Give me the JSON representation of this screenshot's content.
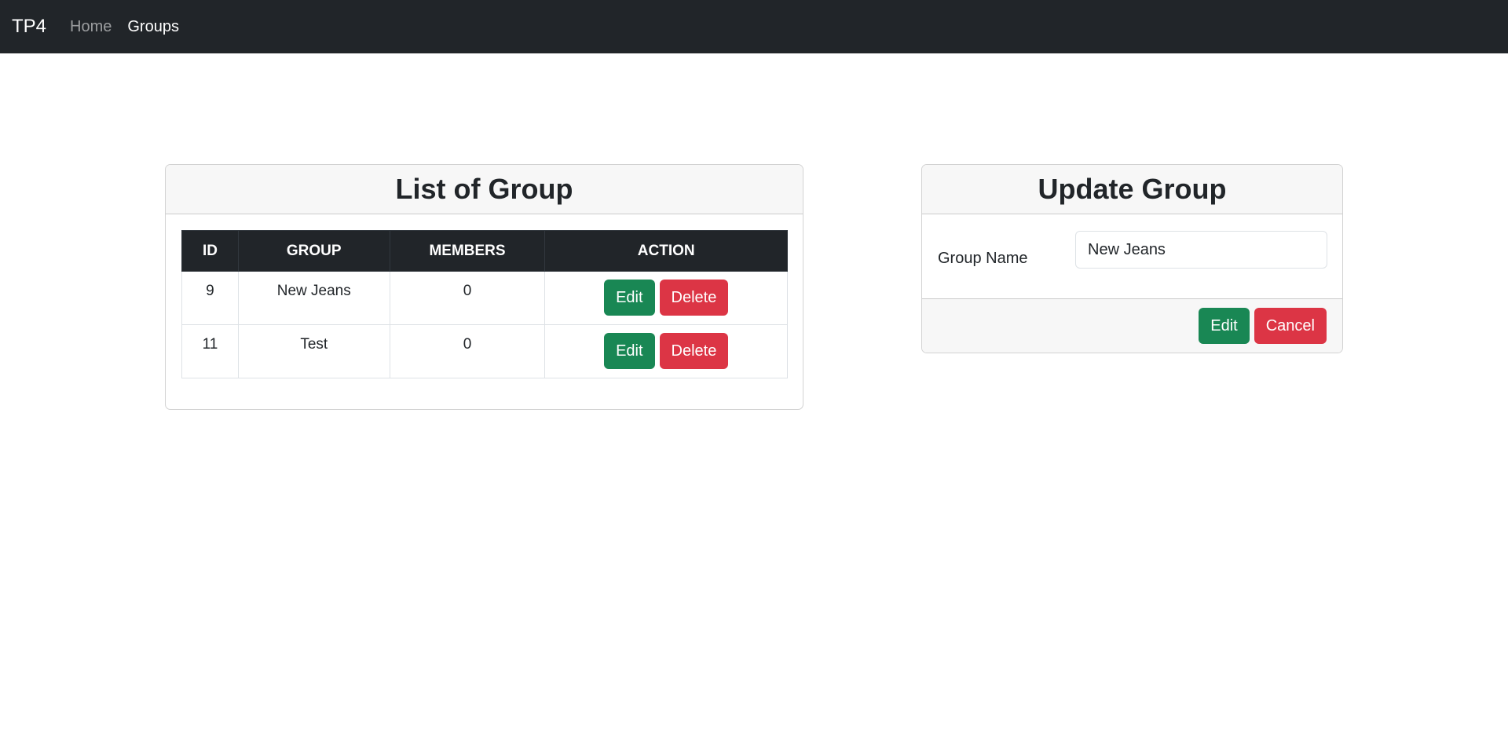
{
  "navbar": {
    "brand": "TP4",
    "links": [
      {
        "label": "Home",
        "active": false
      },
      {
        "label": "Groups",
        "active": true
      }
    ]
  },
  "list_card": {
    "title": "List of Group",
    "columns": [
      "ID",
      "GROUP",
      "MEMBERS",
      "ACTION"
    ],
    "rows": [
      {
        "id": "9",
        "group": "New Jeans",
        "members": "0",
        "edit_label": "Edit",
        "delete_label": "Delete"
      },
      {
        "id": "11",
        "group": "Test",
        "members": "0",
        "edit_label": "Edit",
        "delete_label": "Delete"
      }
    ]
  },
  "update_card": {
    "title": "Update Group",
    "field_label": "Group Name",
    "field_value": "New Jeans",
    "edit_label": "Edit",
    "cancel_label": "Cancel"
  },
  "colors": {
    "navbar_bg": "#212529",
    "success": "#198754",
    "danger": "#dc3545",
    "header_bg": "#f7f7f7"
  }
}
